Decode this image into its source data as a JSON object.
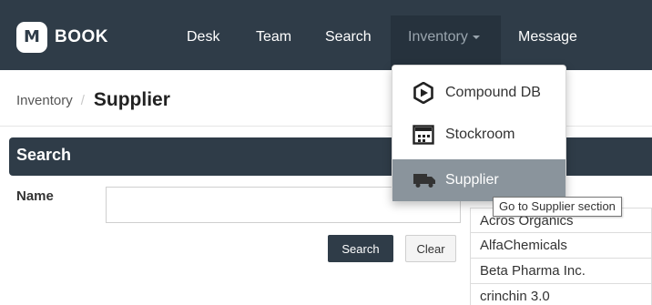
{
  "navbar": {
    "logo_letter": "M",
    "brand": "BOOK",
    "items": [
      "Desk",
      "Team",
      "Search",
      "Inventory",
      "Message"
    ],
    "active_item": "Inventory"
  },
  "breadcrumb": {
    "parent": "Inventory",
    "separator": "/",
    "current": "Supplier"
  },
  "search_panel": {
    "title": "Search",
    "name_label": "Name",
    "name_value": "",
    "search_button": "Search",
    "clear_button": "Clear"
  },
  "results": [
    "Acros Organics",
    "AlfaChemicals",
    "Beta Pharma Inc.",
    "crinchin 3.0"
  ],
  "dropdown": {
    "items": [
      {
        "label": "Compound DB",
        "icon": "compound-db-icon"
      },
      {
        "label": "Stockroom",
        "icon": "stockroom-icon"
      },
      {
        "label": "Supplier",
        "icon": "truck-icon"
      }
    ],
    "active_index": 2
  },
  "tooltip": "Go to Supplier section",
  "colors": {
    "navbar": "#2f3c48",
    "dropdown_active": "#8a949c",
    "inactive_nav_text": "#9aa5ae"
  }
}
